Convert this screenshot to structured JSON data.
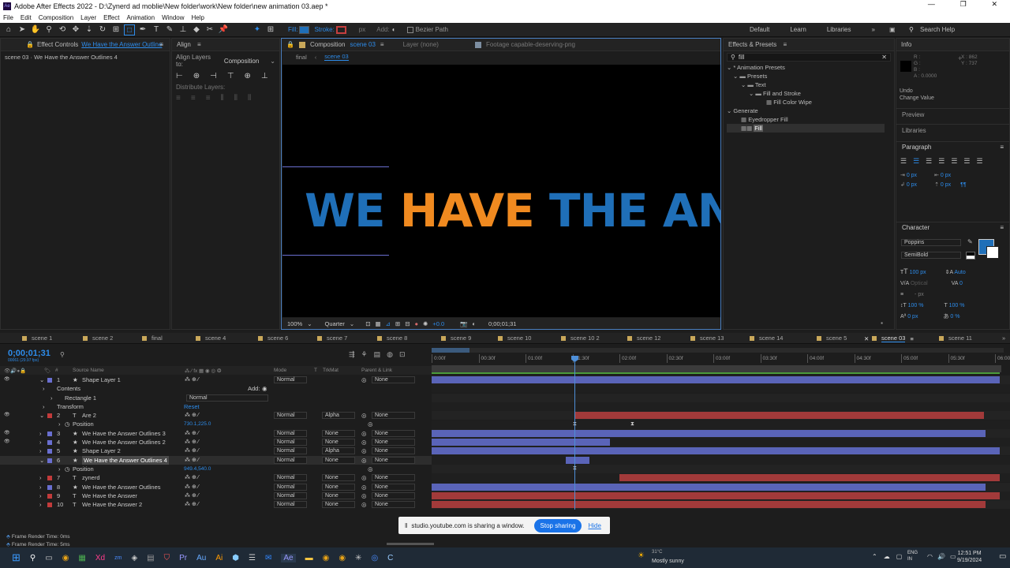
{
  "window": {
    "title": "Adobe After Effects 2022 - D:\\Zynerd ad moblie\\New folder\\work\\New folder\\new animation 03.aep *",
    "controls": [
      "—",
      "❐",
      "✕"
    ]
  },
  "menu": [
    "File",
    "Edit",
    "Composition",
    "Layer",
    "Effect",
    "Animation",
    "Window",
    "Help"
  ],
  "toolbar": {
    "fill": "Fill:",
    "stroke": "Stroke:",
    "px": "px",
    "add": "Add:",
    "bezier": "Bezier Path",
    "workspaces": [
      "Default",
      "Learn",
      "Libraries"
    ],
    "search": "Search Help"
  },
  "effect_controls": {
    "tab": "Effect Controls",
    "tab_target": "We Have the Answer Outline",
    "subtitle": "scene 03 · We Have the Answer Outlines 4"
  },
  "align": {
    "title": "Align",
    "align_to_label": "Align Layers to:",
    "align_to_value": "Composition",
    "distribute": "Distribute Layers:"
  },
  "comp": {
    "tab": "Composition",
    "tab_name": "scene 03",
    "layer_tab": "Layer (none)",
    "footage_tab": "Footage capable-deserving-png",
    "breadcrumb": [
      "final",
      "scene 03"
    ],
    "text_parts": [
      "WE ",
      "HAVE ",
      "THE AN"
    ],
    "zoom": "100%",
    "quality": "Quarter",
    "exposure": "+0.0",
    "timecode": "0;00;01;31"
  },
  "effects_presets": {
    "title": "Effects & Presets",
    "search": "fill",
    "tree": [
      {
        "label": "* Animation Presets",
        "lvl": 0
      },
      {
        "label": "Presets",
        "lvl": 1
      },
      {
        "label": "Text",
        "lvl": 2
      },
      {
        "label": "Fill and Stroke",
        "lvl": 3
      },
      {
        "label": "Fill Color Wipe",
        "lvl": 4
      },
      {
        "label": "Generate",
        "lvl": 0
      },
      {
        "label": "Eyedropper Fill",
        "lvl": 1
      },
      {
        "label": "Fill",
        "lvl": 1
      }
    ]
  },
  "info": {
    "title": "Info",
    "r": "R :",
    "g": "G :",
    "b": "B :",
    "a": "A : 0.0000",
    "x": "X : 862",
    "y": "Y : 737",
    "undo": "Undo",
    "undo_action": "Change Value",
    "preview": "Preview",
    "libraries": "Libraries"
  },
  "paragraph": {
    "title": "Paragraph",
    "vals": [
      "0 px",
      "0 px",
      "0 px",
      "0 px",
      "0 px"
    ]
  },
  "character": {
    "title": "Character",
    "font": "Poppins",
    "style": "SemiBold",
    "size": "100 px",
    "leading": "Auto",
    "kerning": "Optical",
    "tracking": "0",
    "stroke": "- px",
    "vscale": "100 %",
    "hscale": "100 %",
    "baseline": "0 px",
    "tsume": "0 %"
  },
  "comp_tabs": [
    "scene 1",
    "scene 2",
    "final",
    "scene 4",
    "scene 6",
    "scene 7",
    "scene 8",
    "scene 9",
    "scene 10",
    "scene 10 2",
    "scene 12",
    "scene 13",
    "scene 14",
    "scene 5",
    "scene 03",
    "scene 11"
  ],
  "timeline": {
    "timecode": "0;00;01;31",
    "fps": "00061 (29.97 fps)",
    "col_source": "Source Name",
    "col_mode": "Mode",
    "col_t": "T",
    "col_trkmat": "TrkMat",
    "col_parent": "Parent & Link",
    "ruler": [
      "0:00f",
      "00:30f",
      "01:00f",
      "01:30f",
      "02:00f",
      "02:30f",
      "03:00f",
      "03:30f",
      "04:00f",
      "04:30f",
      "05:00f",
      "05:30f",
      "06:00"
    ]
  },
  "layers": [
    {
      "num": "1",
      "name": "Shape Layer 1",
      "mode": "Normal",
      "trk": "",
      "parent": "None",
      "color": "#6a6fd0",
      "type": "★"
    },
    {
      "num": "",
      "name": "Contents",
      "mode": "",
      "trk": "",
      "parent": "",
      "color": "",
      "type": "",
      "add": "Add:"
    },
    {
      "num": "",
      "name": "Rectangle 1",
      "mode": "Normal",
      "trk": "",
      "parent": "",
      "color": "",
      "type": ""
    },
    {
      "num": "",
      "name": "Transform",
      "mode": "Reset",
      "trk": "",
      "parent": "",
      "color": "",
      "type": ""
    },
    {
      "num": "2",
      "name": "Are 2",
      "mode": "Normal",
      "trk": "Alpha",
      "parent": "None",
      "color": "#c23b3b",
      "type": "T"
    },
    {
      "num": "",
      "name": "Position",
      "mode": "",
      "trk": "",
      "parent": "",
      "color": "",
      "type": "",
      "val": "730.1,225.0"
    },
    {
      "num": "3",
      "name": "We Have the Answer Outlines 3",
      "mode": "Normal",
      "trk": "None",
      "parent": "None",
      "color": "#6a6fd0",
      "type": "★"
    },
    {
      "num": "4",
      "name": "We Have the Answer Outlines 2",
      "mode": "Normal",
      "trk": "None",
      "parent": "None",
      "color": "#6a6fd0",
      "type": "★"
    },
    {
      "num": "5",
      "name": "Shape Layer 2",
      "mode": "Normal",
      "trk": "Alpha",
      "parent": "None",
      "color": "#6a6fd0",
      "type": "★"
    },
    {
      "num": "6",
      "name": "We Have the Answer Outlines 4",
      "mode": "Normal",
      "trk": "None",
      "parent": "None",
      "color": "#6a6fd0",
      "type": "★"
    },
    {
      "num": "",
      "name": "Position",
      "mode": "",
      "trk": "",
      "parent": "",
      "color": "",
      "type": "",
      "val": "949.4,540.0"
    },
    {
      "num": "7",
      "name": "zynerd",
      "mode": "Normal",
      "trk": "None",
      "parent": "None",
      "color": "#c23b3b",
      "type": "T"
    },
    {
      "num": "8",
      "name": "We Have the Answer Outlines",
      "mode": "Normal",
      "trk": "None",
      "parent": "None",
      "color": "#6a6fd0",
      "type": "★"
    },
    {
      "num": "9",
      "name": "We Have the Answer",
      "mode": "Normal",
      "trk": "None",
      "parent": "None",
      "color": "#c23b3b",
      "type": "T"
    },
    {
      "num": "10",
      "name": "We Have the Answer 2",
      "mode": "Normal",
      "trk": "None",
      "parent": "None",
      "color": "#c23b3b",
      "type": "T"
    }
  ],
  "render": {
    "l1": "Frame Render Time: 0ms",
    "l2": "Frame Render Time: 5ms"
  },
  "sharing": {
    "text": "studio.youtube.com is sharing a window.",
    "stop": "Stop sharing",
    "hide": "Hide"
  },
  "taskbar": {
    "weather_temp": "31°C",
    "weather": "Mostly sunny",
    "lang": "ENG",
    "region": "IN",
    "time": "12:51 PM",
    "date": "9/19/2024"
  }
}
